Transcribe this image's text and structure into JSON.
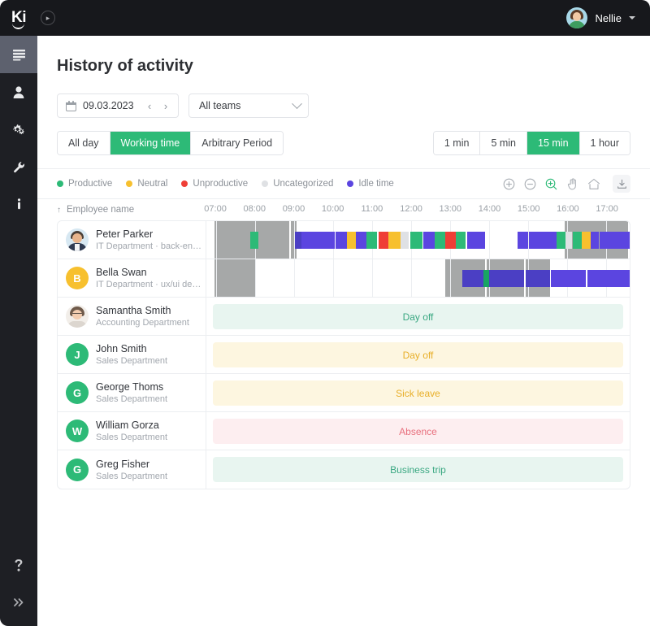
{
  "topbar": {
    "logo_text": "Ki",
    "expand_icon": "chevron-right-icon",
    "user_name": "Nellie",
    "caret_icon": "chevron-down-icon"
  },
  "sidebar": {
    "items": [
      {
        "icon": "list-icon",
        "name": "reports",
        "active": true
      },
      {
        "icon": "user-icon",
        "name": "employees",
        "active": false
      },
      {
        "icon": "gears-icon",
        "name": "settings",
        "active": false
      },
      {
        "icon": "wrench-icon",
        "name": "tools",
        "active": false
      },
      {
        "icon": "info-icon",
        "name": "info",
        "active": false
      }
    ],
    "bottom_items": [
      {
        "icon": "help-icon",
        "name": "help"
      },
      {
        "icon": "chevrons-right-icon",
        "name": "collapse"
      }
    ]
  },
  "page": {
    "title": "History of activity"
  },
  "filters": {
    "date_icon": "calendar-icon",
    "date_value": "09.03.2023",
    "prev_label": "‹",
    "next_label": "›",
    "team_value": "All teams",
    "period_tabs": [
      {
        "label": "All day",
        "active": false
      },
      {
        "label": "Working time",
        "active": true
      },
      {
        "label": "Arbitrary Period",
        "active": false
      }
    ],
    "interval_tabs": [
      {
        "label": "1 min",
        "active": false
      },
      {
        "label": "5 min",
        "active": false
      },
      {
        "label": "15 min",
        "active": true
      },
      {
        "label": "1 hour",
        "active": false
      }
    ]
  },
  "legend": {
    "items": [
      {
        "label": "Productive",
        "color": "#2dba77"
      },
      {
        "label": "Neutral",
        "color": "#f7c02e"
      },
      {
        "label": "Unproductive",
        "color": "#ef3e36"
      },
      {
        "label": "Uncategorized",
        "color": "#dfe1e4"
      },
      {
        "label": "Idle time",
        "color": "#5b45e0"
      }
    ],
    "tools": [
      {
        "name": "zoom-in-circle-icon",
        "active": false
      },
      {
        "name": "zoom-out-circle-icon",
        "active": false
      },
      {
        "name": "zoom-select-icon",
        "active": true
      },
      {
        "name": "hand-icon",
        "active": false
      },
      {
        "name": "home-icon",
        "active": false
      },
      {
        "name": "download-icon",
        "active": false
      }
    ],
    "active_tool_color": "#2dba77"
  },
  "table": {
    "sort_icon": "sort-asc-icon",
    "name_header": "Employee name",
    "time_ticks": [
      "07:00",
      "08:00",
      "09:00",
      "10:00",
      "11:00",
      "12:00",
      "13:00",
      "14:00",
      "15:00",
      "16:00",
      "17:00"
    ],
    "axis_start_hour": 6.75,
    "axis_end_hour": 17.6,
    "rows": [
      {
        "name": "Peter Parker",
        "dept": "IT Department · back-end de...",
        "avatar_type": "photo-male",
        "avatar_letter": "P",
        "avatar_color": "#d7e8f2",
        "type": "timeline",
        "work_blocks": [
          {
            "start": 6.95,
            "end": 8.0
          },
          {
            "start": 8.03,
            "end": 8.88
          },
          {
            "start": 8.91,
            "end": 9.06
          },
          {
            "start": 15.93,
            "end": 17.55
          }
        ],
        "activity": [
          {
            "start": 7.87,
            "end": 8.08,
            "color": "#2dba77"
          },
          {
            "start": 9.02,
            "end": 9.18,
            "color": "#4b3fc4"
          },
          {
            "start": 9.18,
            "end": 10.05,
            "color": "#5b45e0"
          },
          {
            "start": 10.07,
            "end": 10.35,
            "color": "#5b45e0"
          },
          {
            "start": 10.35,
            "end": 10.58,
            "color": "#f7c02e"
          },
          {
            "start": 10.58,
            "end": 10.85,
            "color": "#5b45e0"
          },
          {
            "start": 10.85,
            "end": 11.13,
            "color": "#2dba77"
          },
          {
            "start": 11.16,
            "end": 11.42,
            "color": "#ef3e36"
          },
          {
            "start": 11.42,
            "end": 11.73,
            "color": "#f7c02e"
          },
          {
            "start": 11.73,
            "end": 11.93,
            "color": "#dfe1e4"
          },
          {
            "start": 11.97,
            "end": 12.28,
            "color": "#2dba77"
          },
          {
            "start": 12.3,
            "end": 12.6,
            "color": "#5b45e0"
          },
          {
            "start": 12.6,
            "end": 12.88,
            "color": "#2dba77"
          },
          {
            "start": 12.88,
            "end": 13.15,
            "color": "#ef3e36"
          },
          {
            "start": 13.15,
            "end": 13.4,
            "color": "#2dba77"
          },
          {
            "start": 13.43,
            "end": 13.9,
            "color": "#5b45e0"
          },
          {
            "start": 14.72,
            "end": 15.0,
            "color": "#5b45e0"
          },
          {
            "start": 15.02,
            "end": 15.72,
            "color": "#5b45e0"
          },
          {
            "start": 15.72,
            "end": 15.95,
            "color": "#2dba77"
          },
          {
            "start": 15.95,
            "end": 16.12,
            "color": "#dfe1e4"
          },
          {
            "start": 16.15,
            "end": 16.37,
            "color": "#2dba77"
          },
          {
            "start": 16.37,
            "end": 16.6,
            "color": "#f7c02e"
          },
          {
            "start": 16.6,
            "end": 16.8,
            "color": "#5b45e0"
          },
          {
            "start": 16.82,
            "end": 17.6,
            "color": "#5b45e0"
          }
        ]
      },
      {
        "name": "Bella Swan",
        "dept": "IT Department · ux/ui design...",
        "avatar_type": "letter",
        "avatar_letter": "B",
        "avatar_color": "#f7c02e",
        "type": "timeline",
        "work_blocks": [
          {
            "start": 6.95,
            "end": 8.0
          },
          {
            "start": 12.88,
            "end": 13.9
          },
          {
            "start": 13.93,
            "end": 14.9
          },
          {
            "start": 14.93,
            "end": 15.55
          }
        ],
        "activity": [
          {
            "start": 13.3,
            "end": 13.85,
            "color": "#4b3fc4"
          },
          {
            "start": 13.85,
            "end": 14.0,
            "color": "#19a463"
          },
          {
            "start": 14.0,
            "end": 14.9,
            "color": "#4b3fc4"
          },
          {
            "start": 14.93,
            "end": 15.55,
            "color": "#4b3fc4"
          },
          {
            "start": 15.57,
            "end": 16.48,
            "color": "#5b45e0"
          },
          {
            "start": 16.52,
            "end": 17.6,
            "color": "#5b45e0"
          }
        ]
      },
      {
        "name": "Samantha Smith",
        "dept": "Accounting Department",
        "avatar_type": "photo-female",
        "avatar_letter": "S",
        "avatar_color": "#f2eee9",
        "type": "status",
        "status_label": "Day off",
        "status_bg": "#e8f5f0",
        "status_color": "#3aa882"
      },
      {
        "name": "John Smith",
        "dept": "Sales Department",
        "avatar_type": "letter",
        "avatar_letter": "J",
        "avatar_color": "#2dba77",
        "type": "status",
        "status_label": "Day off",
        "status_bg": "#fdf6e0",
        "status_color": "#e8af29"
      },
      {
        "name": "George Thoms",
        "dept": "Sales Department",
        "avatar_type": "letter",
        "avatar_letter": "G",
        "avatar_color": "#2dba77",
        "type": "status",
        "status_label": "Sick leave",
        "status_bg": "#fdf6e0",
        "status_color": "#e8af29"
      },
      {
        "name": "William Gorza",
        "dept": "Sales Department",
        "avatar_type": "letter",
        "avatar_letter": "W",
        "avatar_color": "#2dba77",
        "type": "status",
        "status_label": "Absence",
        "status_bg": "#fdeef0",
        "status_color": "#e8707e"
      },
      {
        "name": "Greg Fisher",
        "dept": "Sales Department",
        "avatar_type": "letter",
        "avatar_letter": "G",
        "avatar_color": "#2dba77",
        "type": "status",
        "status_label": "Business trip",
        "status_bg": "#e8f5f0",
        "status_color": "#3aa882"
      }
    ]
  }
}
